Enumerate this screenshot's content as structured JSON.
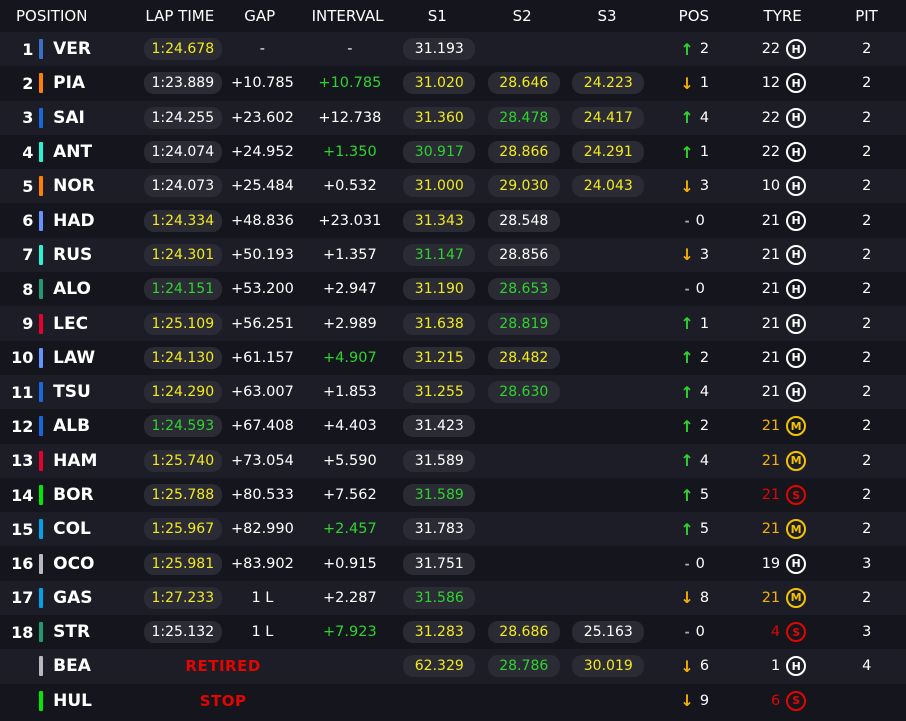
{
  "headers": {
    "position": "POSITION",
    "lap_time": "LAP TIME",
    "gap": "GAP",
    "interval": "INTERVAL",
    "s1": "S1",
    "s2": "S2",
    "s3": "S3",
    "pos": "POS",
    "tyre": "TYRE",
    "pit": "PIT"
  },
  "rows": [
    {
      "pos": "1",
      "code": "VER",
      "team": "#3671c6",
      "lap": "1:24.678",
      "lap_c": "yellow",
      "gap": "-",
      "int": "-",
      "int_c": "white",
      "s1": "31.193",
      "s1_c": "white",
      "s2": "",
      "s2_c": "white",
      "s3": "",
      "s3_c": "white",
      "dir": "up",
      "change": "2",
      "age": "22",
      "age_c": "white",
      "tyre": "H",
      "pit": "2"
    },
    {
      "pos": "2",
      "code": "PIA",
      "team": "#ff8000",
      "lap": "1:23.889",
      "lap_c": "white",
      "gap": "+10.785",
      "int": "+10.785",
      "int_c": "green",
      "s1": "31.020",
      "s1_c": "yellow",
      "s2": "28.646",
      "s2_c": "yellow",
      "s3": "24.223",
      "s3_c": "yellow",
      "dir": "down",
      "change": "1",
      "age": "12",
      "age_c": "white",
      "tyre": "H",
      "pit": "2"
    },
    {
      "pos": "3",
      "code": "SAI",
      "team": "#1868db",
      "lap": "1:24.255",
      "lap_c": "white",
      "gap": "+23.602",
      "int": "+12.738",
      "int_c": "white",
      "s1": "31.360",
      "s1_c": "yellow",
      "s2": "28.478",
      "s2_c": "green",
      "s3": "24.417",
      "s3_c": "yellow",
      "dir": "up",
      "change": "4",
      "age": "22",
      "age_c": "white",
      "tyre": "H",
      "pit": "2"
    },
    {
      "pos": "4",
      "code": "ANT",
      "team": "#27f4d2",
      "lap": "1:24.074",
      "lap_c": "white",
      "gap": "+24.952",
      "int": "+1.350",
      "int_c": "green",
      "s1": "30.917",
      "s1_c": "green",
      "s2": "28.866",
      "s2_c": "yellow",
      "s3": "24.291",
      "s3_c": "yellow",
      "dir": "up",
      "change": "1",
      "age": "22",
      "age_c": "white",
      "tyre": "H",
      "pit": "2"
    },
    {
      "pos": "5",
      "code": "NOR",
      "team": "#ff8000",
      "lap": "1:24.073",
      "lap_c": "white",
      "gap": "+25.484",
      "int": "+0.532",
      "int_c": "white",
      "s1": "31.000",
      "s1_c": "yellow",
      "s2": "29.030",
      "s2_c": "yellow",
      "s3": "24.043",
      "s3_c": "yellow",
      "dir": "down",
      "change": "3",
      "age": "10",
      "age_c": "white",
      "tyre": "H",
      "pit": "2"
    },
    {
      "pos": "6",
      "code": "HAD",
      "team": "#6692ff",
      "lap": "1:24.334",
      "lap_c": "yellow",
      "gap": "+48.836",
      "int": "+23.031",
      "int_c": "white",
      "s1": "31.343",
      "s1_c": "yellow",
      "s2": "28.548",
      "s2_c": "white",
      "s3": "",
      "s3_c": "white",
      "dir": "none",
      "change": "0",
      "age": "21",
      "age_c": "white",
      "tyre": "H",
      "pit": "2"
    },
    {
      "pos": "7",
      "code": "RUS",
      "team": "#27f4d2",
      "lap": "1:24.301",
      "lap_c": "yellow",
      "gap": "+50.193",
      "int": "+1.357",
      "int_c": "white",
      "s1": "31.147",
      "s1_c": "green",
      "s2": "28.856",
      "s2_c": "white",
      "s3": "",
      "s3_c": "white",
      "dir": "down",
      "change": "3",
      "age": "21",
      "age_c": "white",
      "tyre": "H",
      "pit": "2"
    },
    {
      "pos": "8",
      "code": "ALO",
      "team": "#229971",
      "lap": "1:24.151",
      "lap_c": "green",
      "gap": "+53.200",
      "int": "+2.947",
      "int_c": "white",
      "s1": "31.190",
      "s1_c": "yellow",
      "s2": "28.653",
      "s2_c": "green",
      "s3": "",
      "s3_c": "white",
      "dir": "none",
      "change": "0",
      "age": "21",
      "age_c": "white",
      "tyre": "H",
      "pit": "2"
    },
    {
      "pos": "9",
      "code": "LEC",
      "team": "#e8002d",
      "lap": "1:25.109",
      "lap_c": "yellow",
      "gap": "+56.251",
      "int": "+2.989",
      "int_c": "white",
      "s1": "31.638",
      "s1_c": "yellow",
      "s2": "28.819",
      "s2_c": "green",
      "s3": "",
      "s3_c": "white",
      "dir": "up",
      "change": "1",
      "age": "21",
      "age_c": "white",
      "tyre": "H",
      "pit": "2"
    },
    {
      "pos": "10",
      "code": "LAW",
      "team": "#6692ff",
      "lap": "1:24.130",
      "lap_c": "yellow",
      "gap": "+61.157",
      "int": "+4.907",
      "int_c": "green",
      "s1": "31.215",
      "s1_c": "yellow",
      "s2": "28.482",
      "s2_c": "yellow",
      "s3": "",
      "s3_c": "white",
      "dir": "up",
      "change": "2",
      "age": "21",
      "age_c": "white",
      "tyre": "H",
      "pit": "2"
    },
    {
      "pos": "11",
      "code": "TSU",
      "team": "#1868db",
      "lap": "1:24.290",
      "lap_c": "yellow",
      "gap": "+63.007",
      "int": "+1.853",
      "int_c": "white",
      "s1": "31.255",
      "s1_c": "yellow",
      "s2": "28.630",
      "s2_c": "green",
      "s3": "",
      "s3_c": "white",
      "dir": "up",
      "change": "4",
      "age": "21",
      "age_c": "white",
      "tyre": "H",
      "pit": "2"
    },
    {
      "pos": "12",
      "code": "ALB",
      "team": "#1868db",
      "lap": "1:24.593",
      "lap_c": "green",
      "gap": "+67.408",
      "int": "+4.403",
      "int_c": "white",
      "s1": "31.423",
      "s1_c": "white",
      "s2": "",
      "s2_c": "white",
      "s3": "",
      "s3_c": "white",
      "dir": "up",
      "change": "2",
      "age": "21",
      "age_c": "orange",
      "tyre": "M",
      "pit": "2"
    },
    {
      "pos": "13",
      "code": "HAM",
      "team": "#e8002d",
      "lap": "1:25.740",
      "lap_c": "yellow",
      "gap": "+73.054",
      "int": "+5.590",
      "int_c": "white",
      "s1": "31.589",
      "s1_c": "white",
      "s2": "",
      "s2_c": "white",
      "s3": "",
      "s3_c": "white",
      "dir": "up",
      "change": "4",
      "age": "21",
      "age_c": "orange",
      "tyre": "M",
      "pit": "2"
    },
    {
      "pos": "14",
      "code": "BOR",
      "team": "#00e701",
      "lap": "1:25.788",
      "lap_c": "yellow",
      "gap": "+80.533",
      "int": "+7.562",
      "int_c": "white",
      "s1": "31.589",
      "s1_c": "green",
      "s2": "",
      "s2_c": "white",
      "s3": "",
      "s3_c": "white",
      "dir": "up",
      "change": "5",
      "age": "21",
      "age_c": "red",
      "tyre": "S",
      "pit": "2"
    },
    {
      "pos": "15",
      "code": "COL",
      "team": "#00a1e8",
      "lap": "1:25.967",
      "lap_c": "yellow",
      "gap": "+82.990",
      "int": "+2.457",
      "int_c": "green",
      "s1": "31.783",
      "s1_c": "white",
      "s2": "",
      "s2_c": "white",
      "s3": "",
      "s3_c": "white",
      "dir": "up",
      "change": "5",
      "age": "21",
      "age_c": "orange",
      "tyre": "M",
      "pit": "2"
    },
    {
      "pos": "16",
      "code": "OCO",
      "team": "#b6babd",
      "lap": "1:25.981",
      "lap_c": "yellow",
      "gap": "+83.902",
      "int": "+0.915",
      "int_c": "white",
      "s1": "31.751",
      "s1_c": "white",
      "s2": "",
      "s2_c": "white",
      "s3": "",
      "s3_c": "white",
      "dir": "none",
      "change": "0",
      "age": "19",
      "age_c": "white",
      "tyre": "H",
      "pit": "3"
    },
    {
      "pos": "17",
      "code": "GAS",
      "team": "#00a1e8",
      "lap": "1:27.233",
      "lap_c": "yellow",
      "gap": "1 L",
      "int": "+2.287",
      "int_c": "white",
      "s1": "31.586",
      "s1_c": "green",
      "s2": "",
      "s2_c": "white",
      "s3": "",
      "s3_c": "white",
      "dir": "down",
      "change": "8",
      "age": "21",
      "age_c": "orange",
      "tyre": "M",
      "pit": "2"
    },
    {
      "pos": "18",
      "code": "STR",
      "team": "#229971",
      "lap": "1:25.132",
      "lap_c": "white",
      "gap": "1 L",
      "int": "+7.923",
      "int_c": "green",
      "s1": "31.283",
      "s1_c": "yellow",
      "s2": "28.686",
      "s2_c": "yellow",
      "s3": "25.163",
      "s3_c": "white",
      "dir": "none",
      "change": "0",
      "age": "4",
      "age_c": "red",
      "tyre": "S",
      "pit": "3"
    },
    {
      "pos": "",
      "code": "BEA",
      "team": "#b6babd",
      "status": "RETIRED",
      "lap": "",
      "gap": "",
      "int": "",
      "int_c": "white",
      "s1": "62.329",
      "s1_c": "yellow",
      "s2": "28.786",
      "s2_c": "green",
      "s3": "30.019",
      "s3_c": "yellow",
      "dir": "down",
      "change": "6",
      "age": "1",
      "age_c": "white",
      "tyre": "H",
      "pit": "4"
    },
    {
      "pos": "",
      "code": "HUL",
      "team": "#00e701",
      "status": "STOP",
      "lap": "",
      "gap": "",
      "int": "",
      "int_c": "white",
      "s1": "",
      "s1_c": "white",
      "s2": "",
      "s2_c": "white",
      "s3": "",
      "s3_c": "white",
      "dir": "down",
      "change": "9",
      "age": "6",
      "age_c": "red",
      "tyre": "S",
      "pit": ""
    }
  ]
}
